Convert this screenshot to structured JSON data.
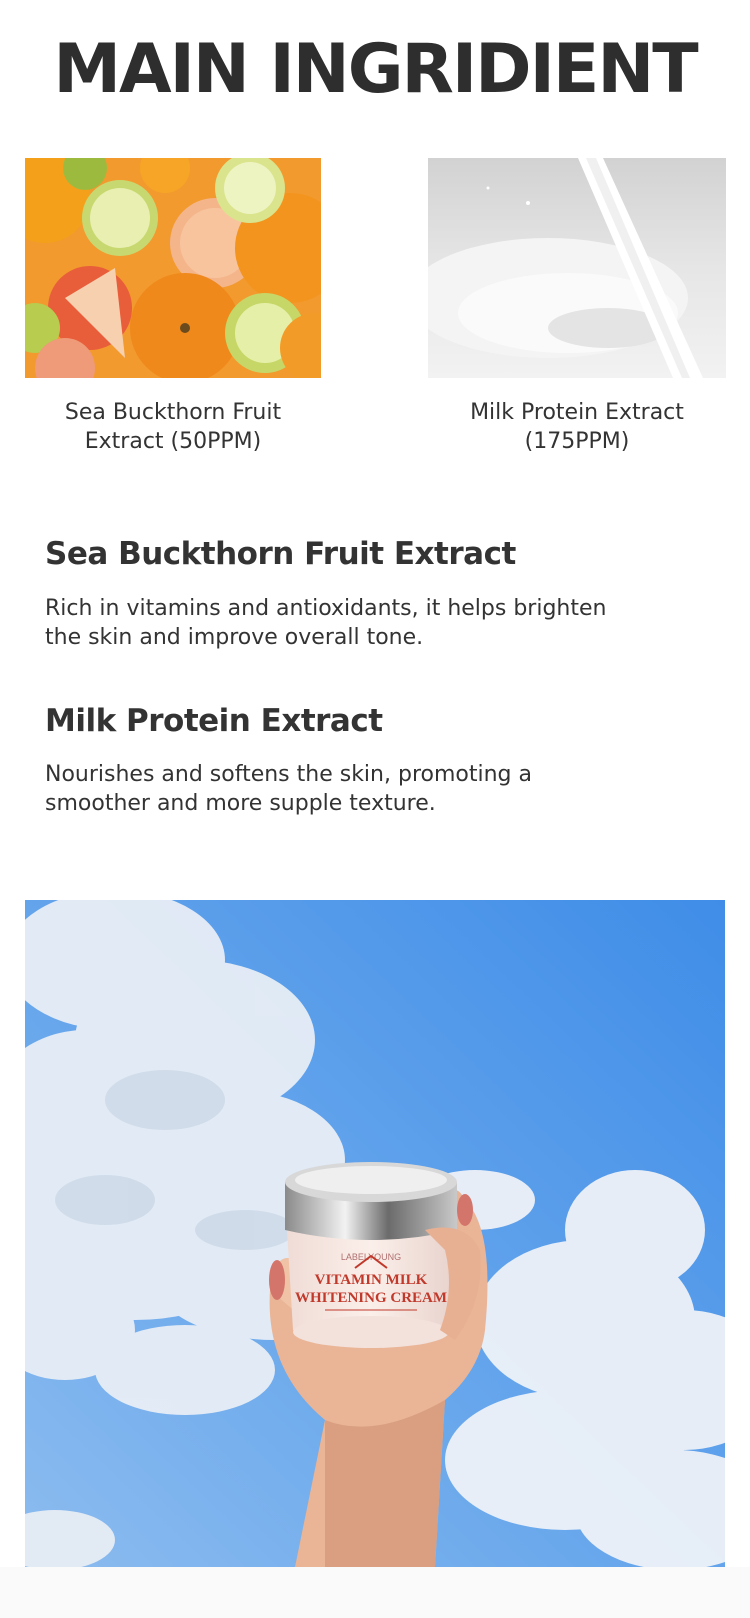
{
  "page": {
    "title": "MAIN INGRIDIENT"
  },
  "ingredients": [
    {
      "caption_line1": "Sea Buckthorn Fruit",
      "caption_line2": "Extract (50PPM)",
      "image": "citrus-fruits-photo"
    },
    {
      "caption_line1": "Milk Protein Extract",
      "caption_line2": "(175PPM)",
      "image": "milk-splash-photo"
    }
  ],
  "details": [
    {
      "heading": "Sea Buckthorn Fruit Extract",
      "text_line1": "Rich in vitamins and antioxidants, it helps brighten",
      "text_line2": "the skin and improve overall tone."
    },
    {
      "heading": "Milk Protein Extract",
      "text_line1": "Nourishes and softens the skin, promoting a",
      "text_line2": "smoother and more supple texture."
    }
  ],
  "product_photo": {
    "jar_brand": "LABELYOUNG",
    "jar_label_line1": "VITAMIN MILK",
    "jar_label_line2": "WHITENING CREAM"
  },
  "colors": {
    "text": "#2f2f2f",
    "sky": "#4a90e2",
    "label_red": "#c0392b"
  }
}
